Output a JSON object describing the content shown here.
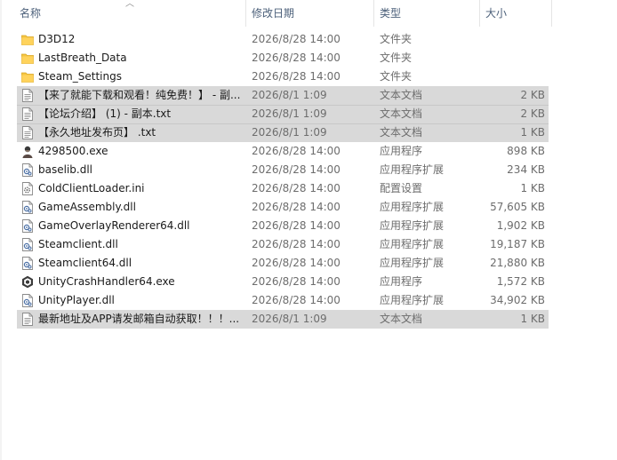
{
  "columns": {
    "name": "名称",
    "modified": "修改日期",
    "type": "类型",
    "size": "大小"
  },
  "files": [
    {
      "name": "D3D12",
      "modified": "2026/8/28 14:00",
      "type": "文件夹",
      "size": "",
      "icon": "folder-icon",
      "selected": false
    },
    {
      "name": "LastBreath_Data",
      "modified": "2026/8/28 14:00",
      "type": "文件夹",
      "size": "",
      "icon": "folder-icon",
      "selected": false
    },
    {
      "name": "Steam_Settings",
      "modified": "2026/8/28 14:00",
      "type": "文件夹",
      "size": "",
      "icon": "folder-icon",
      "selected": false
    },
    {
      "name": "【来了就能下载和观看！纯免费！】 - 副...",
      "modified": "2026/8/1 1:09",
      "type": "文本文档",
      "size": "2 KB",
      "icon": "text-file-icon",
      "selected": true
    },
    {
      "name": "【论坛介绍】 (1) - 副本.txt",
      "modified": "2026/8/1 1:09",
      "type": "文本文档",
      "size": "2 KB",
      "icon": "text-file-icon",
      "selected": true
    },
    {
      "name": "【永久地址发布页】 .txt",
      "modified": "2026/8/1 1:09",
      "type": "文本文档",
      "size": "1 KB",
      "icon": "text-file-icon",
      "selected": true
    },
    {
      "name": "4298500.exe",
      "modified": "2026/8/28 14:00",
      "type": "应用程序",
      "size": "898 KB",
      "icon": "game-exe-icon",
      "selected": false
    },
    {
      "name": "baselib.dll",
      "modified": "2026/8/28 14:00",
      "type": "应用程序扩展",
      "size": "234 KB",
      "icon": "dll-file-icon",
      "selected": false
    },
    {
      "name": "ColdClientLoader.ini",
      "modified": "2026/8/28 14:00",
      "type": "配置设置",
      "size": "1 KB",
      "icon": "ini-file-icon",
      "selected": false
    },
    {
      "name": "GameAssembly.dll",
      "modified": "2026/8/28 14:00",
      "type": "应用程序扩展",
      "size": "57,605 KB",
      "icon": "dll-file-icon",
      "selected": false
    },
    {
      "name": "GameOverlayRenderer64.dll",
      "modified": "2026/8/28 14:00",
      "type": "应用程序扩展",
      "size": "1,902 KB",
      "icon": "dll-file-icon",
      "selected": false
    },
    {
      "name": "Steamclient.dll",
      "modified": "2026/8/28 14:00",
      "type": "应用程序扩展",
      "size": "19,187 KB",
      "icon": "dll-file-icon",
      "selected": false
    },
    {
      "name": "Steamclient64.dll",
      "modified": "2026/8/28 14:00",
      "type": "应用程序扩展",
      "size": "21,880 KB",
      "icon": "dll-file-icon",
      "selected": false
    },
    {
      "name": "UnityCrashHandler64.exe",
      "modified": "2026/8/28 14:00",
      "type": "应用程序",
      "size": "1,572 KB",
      "icon": "unity-icon",
      "selected": false
    },
    {
      "name": "UnityPlayer.dll",
      "modified": "2026/8/28 14:00",
      "type": "应用程序扩展",
      "size": "34,902 KB",
      "icon": "dll-file-icon",
      "selected": false
    },
    {
      "name": "最新地址及APP请发邮箱自动获取！！！...",
      "modified": "2026/8/1 1:09",
      "type": "文本文档",
      "size": "1 KB",
      "icon": "text-file-icon",
      "selected": true
    }
  ],
  "colors": {
    "selection": "#d9d9d9",
    "folder": "#f4c542",
    "header_text": "#4c607a"
  }
}
